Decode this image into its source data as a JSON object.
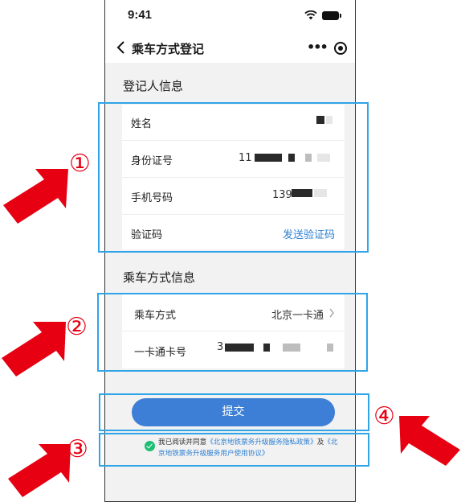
{
  "status_bar": {
    "time": "9:41"
  },
  "navbar": {
    "title": "乘车方式登记"
  },
  "registrant": {
    "section_title": "登记人信息",
    "name_label": "姓名",
    "id_label": "身份证号",
    "id_value_prefix": "11",
    "phone_label": "手机号码",
    "phone_value_prefix": "139",
    "code_label": "验证码",
    "send_code_link": "发送验证码"
  },
  "ride": {
    "section_title": "乘车方式信息",
    "mode_label": "乘车方式",
    "mode_value": "北京一卡通",
    "card_label": "一卡通卡号",
    "card_value_prefix": "3"
  },
  "submit_label": "提交",
  "agreement": {
    "prefix": "我已阅读并同意",
    "privacy_link": "《北京地铁票务升级服务隐私政策》",
    "connector": "及",
    "terms_link": "《北京地铁票务升级服务用户使用协议》"
  },
  "annotations": {
    "marker_1": "①",
    "marker_2": "②",
    "marker_3": "③",
    "marker_4": "④",
    "highlight_color": "#2fa4e7",
    "arrow_color": "#e60012"
  },
  "colors": {
    "accent": "#3d7ed6",
    "link": "#2f80d1",
    "success": "#1dbf73"
  }
}
